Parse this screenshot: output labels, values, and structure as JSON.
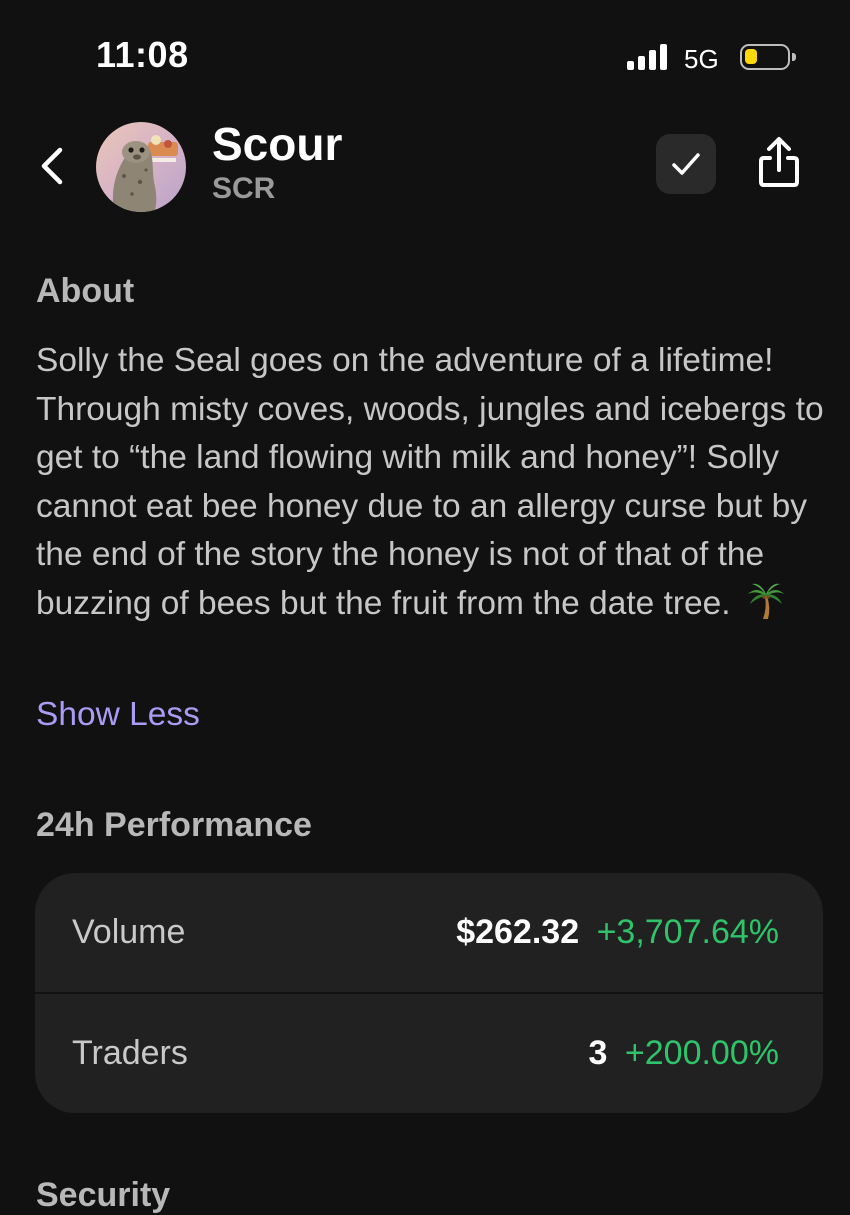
{
  "status_bar": {
    "time": "11:08",
    "network": "5G",
    "battery_level": 0.3,
    "battery_color": "#ffd60a",
    "signal_icon": "cellular-signal-icon"
  },
  "header": {
    "back_icon": "chevron-left-icon",
    "token_name": "Scour",
    "token_symbol": "SCR",
    "check_icon": "checkmark-icon",
    "share_icon": "share-icon"
  },
  "about": {
    "title": "About",
    "text": "Solly the Seal goes on the adventure of a lifetime! Through misty coves, woods, jungles and icebergs to get to “the land flowing with milk and honey”! Solly cannot eat bee honey due to an allergy curse but by the end of the story the honey is not of that of the buzzing of bees but the fruit from the date tree.",
    "emoji_icon": "palm-tree-icon",
    "toggle_label": "Show Less",
    "toggle_color": "#a99cf5"
  },
  "performance": {
    "title": "24h Performance",
    "positive_color": "#30c46a",
    "rows": [
      {
        "label": "Volume",
        "value": "$262.32",
        "change": "+3,707.64%"
      },
      {
        "label": "Traders",
        "value": "3",
        "change": "+200.00%"
      }
    ]
  },
  "security": {
    "title": "Security"
  }
}
